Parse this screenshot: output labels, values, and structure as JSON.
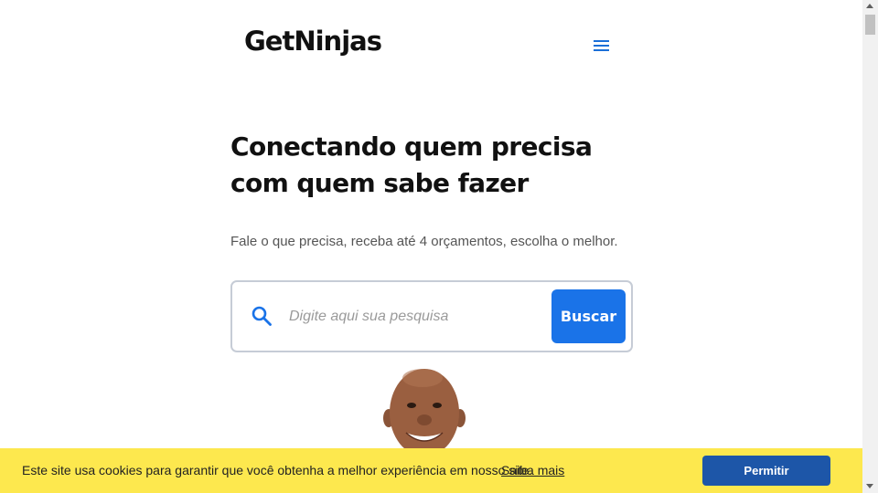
{
  "header": {
    "logo_text": "GetNinjas",
    "menu_icon": "hamburger-menu-icon"
  },
  "hero": {
    "title": "Conectando quem precisa com quem sabe fazer",
    "subtitle": "Fale o que precisa, receba até 4 orçamentos, escolha o melhor."
  },
  "search": {
    "icon": "search-icon",
    "placeholder": "Digite aqui sua pesquisa",
    "value": "",
    "button_label": "Buscar"
  },
  "cookie_banner": {
    "message": "Este site usa cookies para garantir que você obtenha a melhor experiência em nosso site.",
    "link_label": "Saiba mais",
    "accept_label": "Permitir"
  },
  "colors": {
    "accent": "#1a73e8",
    "cookie_background": "#fde84e",
    "cookie_button": "#1d56a8"
  }
}
